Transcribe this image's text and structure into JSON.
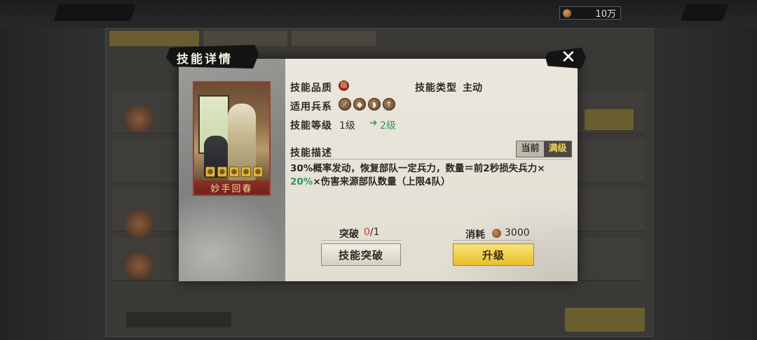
{
  "background": {
    "currency": {
      "amount": "10万",
      "icon": "coin-icon"
    }
  },
  "modal": {
    "title": "技能详情",
    "close_icon": "close-icon",
    "card": {
      "name": "妙手回春",
      "locks": [
        "lock-icon",
        "lock-icon",
        "lock-icon",
        "lock-icon",
        "lock-icon"
      ]
    },
    "quality": {
      "label": "技能品质",
      "badge": "极"
    },
    "type": {
      "label": "技能类型",
      "value": "主动"
    },
    "troops": {
      "label": "适用兵系",
      "icons": [
        "cavalry-icon",
        "shield-icon",
        "bow-icon",
        "spear-icon"
      ]
    },
    "level": {
      "label": "技能等级",
      "current": "1级",
      "next": "2级"
    },
    "description": {
      "label": "技能描述",
      "toggle": {
        "current": "当前",
        "max": "满级",
        "selected": "max"
      },
      "line1": "30%概率发动，恢复部队一定兵力，数量＝前2秒损失兵力×",
      "line2_highlight": "20%",
      "line2_rest": "×伤害来源部队数量（上限4队）"
    },
    "breakthrough": {
      "label": "突破",
      "current": "0",
      "total": "/1",
      "button": "技能突破"
    },
    "cost": {
      "label": "消耗",
      "value": "3000",
      "icon": "coin-icon",
      "button": "升级"
    }
  },
  "colors": {
    "accent_yellow": "#e8bf2c",
    "highlight_green": "#2f9a56",
    "alert_red": "#d0382a",
    "card_border": "#a03c2e"
  }
}
